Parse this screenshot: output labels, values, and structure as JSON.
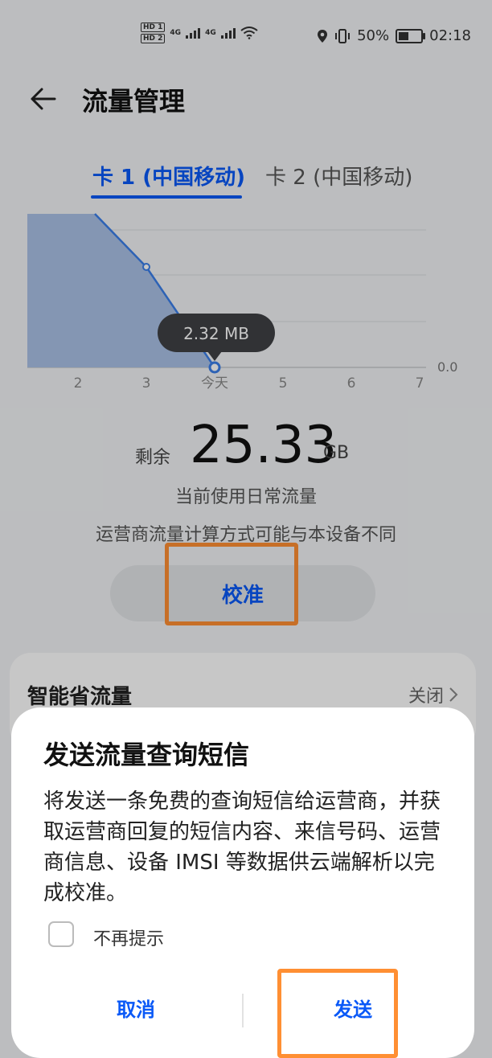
{
  "status_bar": {
    "hd1": "HD 1",
    "hd2": "HD 2",
    "net1": "4G",
    "net2": "4G",
    "battery": "50%",
    "time": "02:18"
  },
  "header": {
    "title": "流量管理"
  },
  "tabs": [
    {
      "label": "卡 1 (中国移动)",
      "active": true
    },
    {
      "label": "卡 2 (中国移动)",
      "active": false
    }
  ],
  "chart_data": {
    "type": "area",
    "x_labels": [
      "2",
      "3",
      "今天",
      "5",
      "6",
      "7"
    ],
    "y_tick": "0.0",
    "tooltip": "2.32 MB",
    "series": [
      {
        "values": [
          {
            "x": "3",
            "y": 0.62
          },
          {
            "x": "今天",
            "y": 0.0
          }
        ]
      }
    ]
  },
  "remaining": {
    "label": "剩余",
    "value": "25.33",
    "unit": "GB"
  },
  "usage_note": "当前使用日常流量",
  "carrier_note": "运营商流量计算方式可能与本设备不同",
  "calibrate_button": "校准",
  "smart_save": {
    "label": "智能省流量",
    "value": "关闭"
  },
  "dialog": {
    "title": "发送流量查询短信",
    "body": "将发送一条免费的查询短信给运营商，并获取运营商回复的短信内容、来信号码、运营商信息、设备 IMSI 等数据供云端解析以完成校准。",
    "checkbox_label": "不再提示",
    "cancel": "取消",
    "send": "发送"
  },
  "colors": {
    "accent": "#0a59f7",
    "highlight": "#ff8f33"
  }
}
